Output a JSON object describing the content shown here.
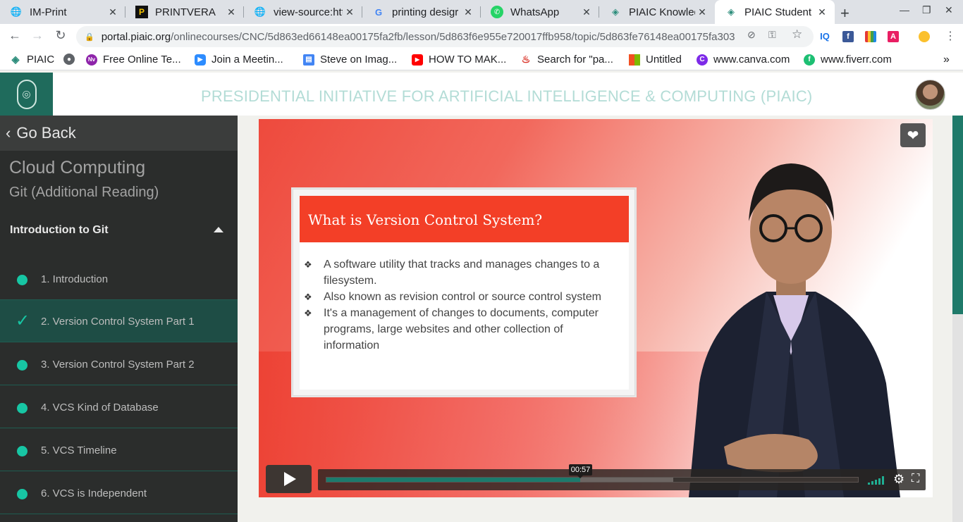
{
  "browser": {
    "tabs": [
      {
        "title": "IM-Print",
        "icon": "globe-icon"
      },
      {
        "title": "PRINTVERA",
        "icon": "printvera-icon"
      },
      {
        "title": "view-source:htt",
        "icon": "globe-icon"
      },
      {
        "title": "printing desigr",
        "icon": "google-icon"
      },
      {
        "title": "WhatsApp",
        "icon": "whatsapp-icon"
      },
      {
        "title": "PIAIC Knowledg",
        "icon": "piaic-icon"
      },
      {
        "title": "PIAIC Student P",
        "icon": "piaic-icon",
        "active": true
      }
    ],
    "close_glyph": "✕",
    "new_tab_glyph": "+",
    "url_domain": "portal.piaic.org",
    "url_path": "/onlinecourses/CNC/5d863ed66148ea00175fa2fb/lesson/5d863f6e955e720017ffb958/topic/5d863fe76148ea00175fa303",
    "bookmarks": [
      {
        "label": "PIAIC",
        "icon": "piaic-icon"
      },
      {
        "label": "",
        "icon": "globe-icon"
      },
      {
        "label": "Free Online Te...",
        "icon": "nv-icon"
      },
      {
        "label": "Join a Meetin...",
        "icon": "zoom-icon"
      },
      {
        "label": "Steve on Imag...",
        "icon": "doc-icon"
      },
      {
        "label": "HOW TO MAK...",
        "icon": "youtube-icon"
      },
      {
        "label": "Search for \"pa...",
        "icon": "fire-icon"
      },
      {
        "label": "Untitled",
        "icon": "microsoft-icon"
      },
      {
        "label": "www.canva.com",
        "icon": "canva-icon"
      },
      {
        "label": "www.fiverr.com",
        "icon": "fiverr-icon"
      }
    ],
    "more_bookmarks_glyph": "»"
  },
  "header": {
    "title": "PRESIDENTIAL INITIATIVE FOR ARTIFICIAL INTELLIGENCE & COMPUTING (PIAIC)"
  },
  "sidebar": {
    "go_back": "Go Back",
    "course_title": "Cloud Computing",
    "course_subtitle": "Git (Additional Reading)",
    "section_title": "Introduction to Git",
    "lessons": [
      {
        "label": "1. Introduction",
        "status": "dot"
      },
      {
        "label": "2. Version Control System Part 1",
        "status": "current"
      },
      {
        "label": "3. Version Control System Part 2",
        "status": "dot"
      },
      {
        "label": "4. VCS Kind of Database",
        "status": "dot"
      },
      {
        "label": "5. VCS Timeline",
        "status": "dot"
      },
      {
        "label": "6. VCS is Independent",
        "status": "dot"
      }
    ]
  },
  "video": {
    "slide_title": "What is Version Control System?",
    "bullets": [
      "A software utility that tracks and manages changes to a filesystem.",
      "Also known as revision control or source control system",
      "It's a management of changes to documents, computer programs, large websites and other collection of information"
    ],
    "bullet_glyph": "❖",
    "time_tooltip": "00:57",
    "progress_played_fraction": 0.477,
    "progress_buffered_fraction": 0.653
  },
  "colors": {
    "accent": "#17c6a4",
    "sidebar_bg": "#2b2d2c",
    "header_title": "#b3dcd6",
    "slide_header": "#f33f27"
  }
}
